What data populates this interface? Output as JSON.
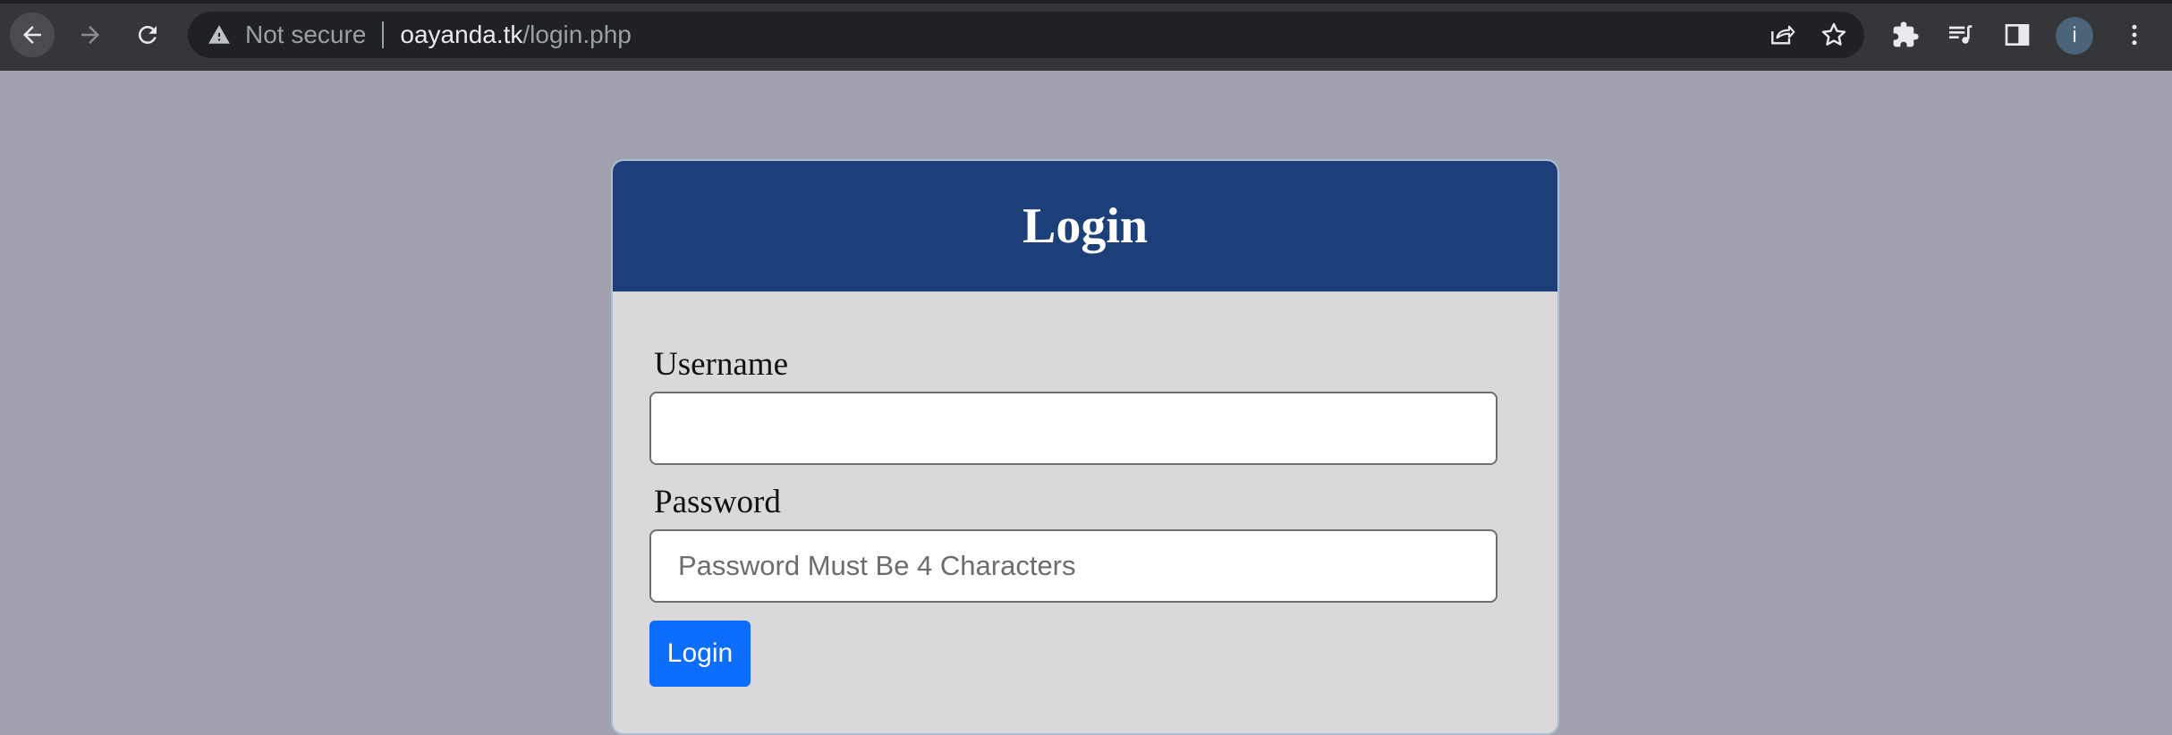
{
  "browser": {
    "security_status": "Not secure",
    "url_host": "oayanda.tk",
    "url_path": "/login.php",
    "profile_initial": "i",
    "icons": [
      "back-arrow-icon",
      "forward-arrow-icon",
      "reload-icon",
      "warning-icon",
      "share-icon",
      "star-icon",
      "extensions-puzzle-icon",
      "reading-list-icon",
      "side-panel-icon",
      "kebab-menu-icon"
    ]
  },
  "login_card": {
    "title": "Login",
    "username_label": "Username",
    "username_value": "",
    "username_placeholder": "",
    "password_label": "Password",
    "password_value": "",
    "password_placeholder": "Password Must Be 4 Characters",
    "submit_label": "Login"
  },
  "colors": {
    "page_background": "#a2a2ae",
    "card_header": "#1c3f79",
    "card_body": "#dad8db",
    "button_primary": "#0d6efd"
  }
}
